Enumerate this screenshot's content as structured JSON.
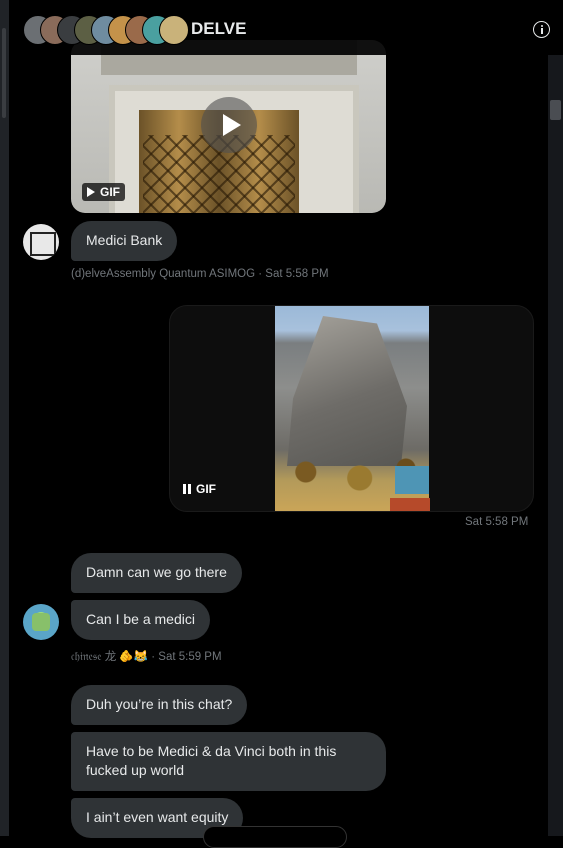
{
  "conversation": {
    "title": "DELVE",
    "avatar_colors": [
      "#6b6f73",
      "#8a6b5a",
      "#3a3d40",
      "#5c5f44",
      "#6f8ca0",
      "#c4924a",
      "#9a6a4a",
      "#4aa0a0",
      "#c9b27a"
    ]
  },
  "header": {
    "info_icon": "info-icon"
  },
  "messages": {
    "media1": {
      "gif_label": "GIF",
      "play_icon": "play-icon"
    },
    "m1": {
      "text": "Medici Bank",
      "meta": "(d)elveAssembly Quantum ASIMOG · Sat 5:58 PM"
    },
    "media2": {
      "gif_label": "GIF",
      "pause_icon": "pause-icon",
      "meta": "Sat 5:58 PM"
    },
    "m2": {
      "text": "Damn can we go there"
    },
    "m3": {
      "text": "Can I be a medici"
    },
    "m3_meta": "𝔠𝔥𝔦𝔫𝔢𝔰𝔢 龙 🫵😹 · Sat 5:59 PM",
    "m4": {
      "text": "Duh you’re in this chat?"
    },
    "m5": {
      "line1": "Have to be Medici & da Vinci both in this",
      "line2": "fucked up world"
    },
    "m6": {
      "text": "I ain’t even want equity"
    }
  }
}
